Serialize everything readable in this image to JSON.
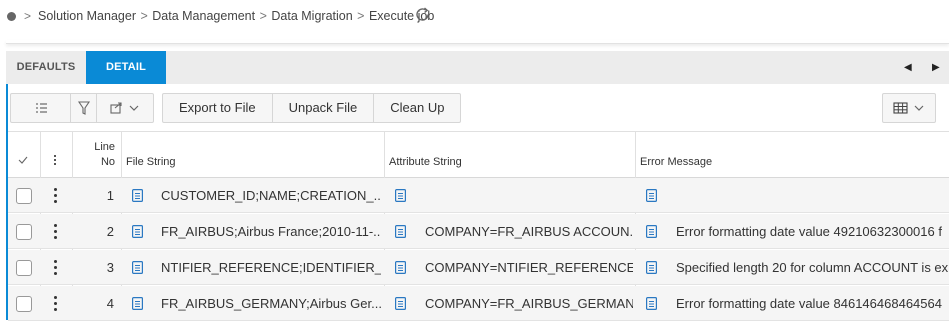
{
  "breadcrumb": {
    "separator": ">",
    "items": [
      "Solution Manager",
      "Data Management",
      "Data Migration",
      "Execute job"
    ]
  },
  "tabs": [
    {
      "label": "DEFAULTS",
      "active": false
    },
    {
      "label": "DETAIL",
      "active": true
    }
  ],
  "toolbar": {
    "buttons": [
      "Export to File",
      "Unpack File",
      "Clean Up"
    ]
  },
  "table": {
    "headers": {
      "line_no_1": "Line",
      "line_no_2": "No",
      "file_string": "File String",
      "attribute_string": "Attribute String",
      "error_message": "Error Message"
    },
    "rows": [
      {
        "line_no": "1",
        "file_string": "CUSTOMER_ID;NAME;CREATION_...",
        "attribute_string": "",
        "error_message": ""
      },
      {
        "line_no": "2",
        "file_string": "FR_AIRBUS;Airbus France;2010-11-...",
        "attribute_string": "COMPANY=FR_AIRBUS ACCOUN...",
        "error_message": "Error formatting date value 49210632300016 f"
      },
      {
        "line_no": "3",
        "file_string": "NTIFIER_REFERENCE;IDENTIFIER_R...",
        "attribute_string": "COMPANY=NTIFIER_REFERENCE",
        "error_message": "Specified length 20 for column ACCOUNT is ex"
      },
      {
        "line_no": "4",
        "file_string": "FR_AIRBUS_GERMANY;Airbus Ger...",
        "attribute_string": "COMPANY=FR_AIRBUS_GERMAN...",
        "error_message": "Error formatting date value 846146468464564"
      }
    ]
  },
  "colors": {
    "accent": "#0a8ad6",
    "doc_icon": "#2a78c2"
  },
  "icons": [
    "status-dot-icon",
    "refresh-icon",
    "list-icon",
    "filter-icon",
    "export-icon",
    "chevron-down-icon",
    "table-layout-icon",
    "checkmark-icon",
    "kebab-icon",
    "document-icon",
    "arrow-left-icon",
    "arrow-right-icon"
  ]
}
